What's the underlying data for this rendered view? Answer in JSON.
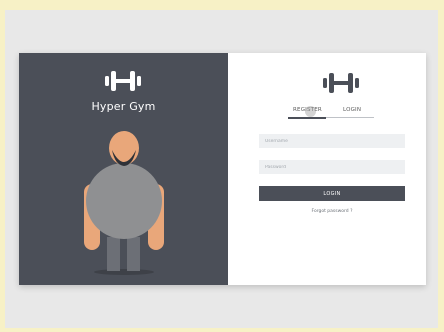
{
  "brand": {
    "name": "Hyper Gym",
    "logo_icon": "dumbbell-icon"
  },
  "tabs": [
    {
      "label": "REGISTER",
      "active": true
    },
    {
      "label": "LOGIN",
      "active": false
    }
  ],
  "form": {
    "username_placeholder": "Username",
    "password_placeholder": "Password",
    "username_value": "",
    "password_value": "",
    "submit_label": "LOGIN",
    "forgot_label": "Forgot password ?"
  },
  "colors": {
    "page_background": "#f7f1c6",
    "stage_background": "#e8e8e8",
    "panel_dark": "#4b4f58",
    "panel_light": "#ffffff",
    "skin": "#e9a77a",
    "body_gray": "#8f9092",
    "pants": "#6c6f76"
  }
}
